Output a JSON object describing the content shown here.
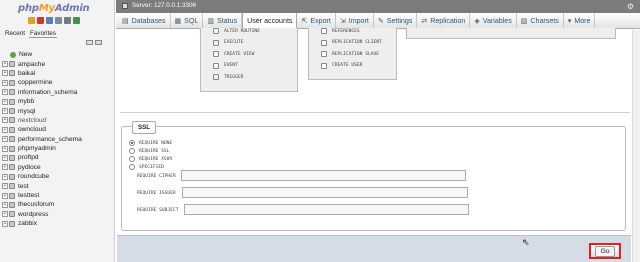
{
  "brand": {
    "php": "php",
    "my": "My",
    "admin": "Admin",
    "icons": [
      "home-icon",
      "logout-icon",
      "help-icon",
      "docs-icon",
      "settings-icon",
      "reload-icon"
    ],
    "icon_colors": [
      "#e8a024",
      "#cc3b2a",
      "#5a7fb5",
      "#7d8a9e",
      "#6f7b8a",
      "#4b8b4b"
    ]
  },
  "nav_tabs": [
    "Recent",
    "Favorites"
  ],
  "databases": [
    {
      "name": "New",
      "type": "new"
    },
    {
      "name": "ampache"
    },
    {
      "name": "baikal"
    },
    {
      "name": "coppermine"
    },
    {
      "name": "information_schema"
    },
    {
      "name": "mybb"
    },
    {
      "name": "mysql"
    },
    {
      "name": "nextcloud",
      "italic": true
    },
    {
      "name": "owncloud"
    },
    {
      "name": "performance_schema"
    },
    {
      "name": "phpmyadmin"
    },
    {
      "name": "proftpd"
    },
    {
      "name": "pydioce"
    },
    {
      "name": "roundcube"
    },
    {
      "name": "test"
    },
    {
      "name": "testtest"
    },
    {
      "name": "thecusforum"
    },
    {
      "name": "wordpress"
    },
    {
      "name": "zabbix"
    }
  ],
  "topbar": {
    "server": "Server: 127.0.0.1:3306"
  },
  "menu": [
    {
      "label": "Databases",
      "icon": "databases-icon",
      "glyph": "▤"
    },
    {
      "label": "SQL",
      "icon": "sql-icon",
      "glyph": "▦"
    },
    {
      "label": "Status",
      "icon": "status-icon",
      "glyph": "▥"
    },
    {
      "label": "User accounts",
      "icon": "user-accounts-icon",
      "glyph": "",
      "active": true
    },
    {
      "label": "Export",
      "icon": "export-icon",
      "glyph": "⇱"
    },
    {
      "label": "Import",
      "icon": "import-icon",
      "glyph": "⇲"
    },
    {
      "label": "Settings",
      "icon": "settings-icon",
      "glyph": "✎"
    },
    {
      "label": "Replication",
      "icon": "replication-icon",
      "glyph": "⇄"
    },
    {
      "label": "Variables",
      "icon": "variables-icon",
      "glyph": "◈"
    },
    {
      "label": "Charsets",
      "icon": "charsets-icon",
      "glyph": "▨"
    },
    {
      "label": "More",
      "icon": "more-icon",
      "glyph": "▾"
    }
  ],
  "privileges_col1": [
    "ALTER ROUTINE",
    "EXECUTE",
    "CREATE VIEW",
    "EVENT",
    "TRIGGER"
  ],
  "privileges_col2": [
    "REFERENCES",
    "REPLICATION CLIENT",
    "REPLICATION SLAVE",
    "CREATE USER"
  ],
  "ssl": {
    "legend": "SSL",
    "options": [
      {
        "label": "REQUIRE NONE",
        "selected": true
      },
      {
        "label": "REQUIRE SSL",
        "selected": false
      },
      {
        "label": "REQUIRE X509",
        "selected": false
      },
      {
        "label": "SPECIFIED",
        "selected": false
      }
    ],
    "fields": [
      {
        "label": "REQUIRE CIPHER",
        "value": ""
      },
      {
        "label": "REQUIRE ISSUER",
        "value": ""
      },
      {
        "label": "REQUIRE SUBJECT",
        "value": ""
      }
    ]
  },
  "footer": {
    "go_label": "Go"
  },
  "colors": {
    "accent_link": "#235a81",
    "highlight": "#dd2222",
    "footer_bg": "#d6dce6"
  }
}
